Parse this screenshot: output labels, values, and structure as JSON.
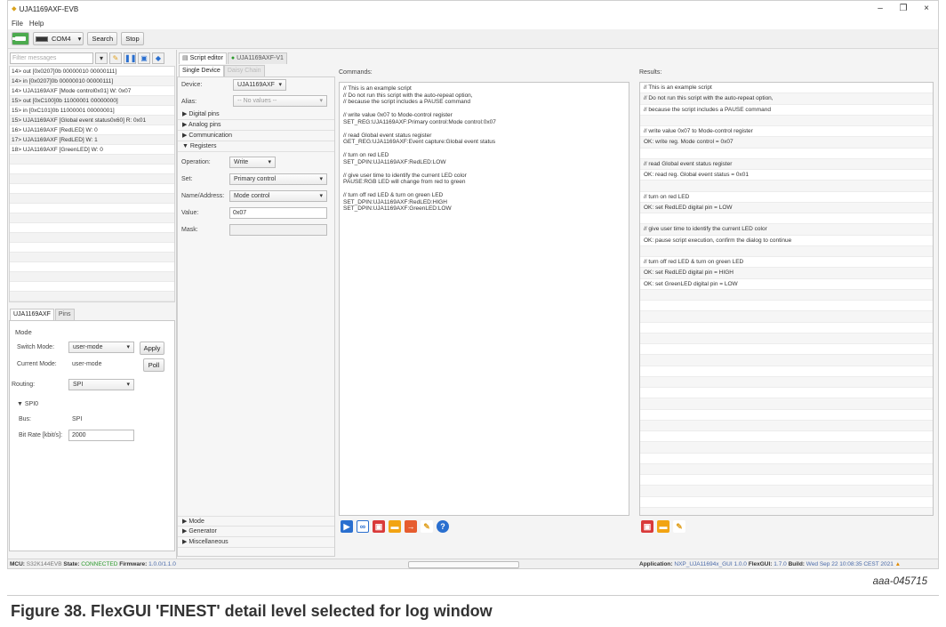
{
  "window": {
    "title": "UJA1169AXF-EVB",
    "min": "–",
    "max": "❐",
    "close": "×"
  },
  "menu": [
    "File",
    "Help"
  ],
  "toolbar": {
    "port": "COM4",
    "search": "Search",
    "stop": "Stop"
  },
  "log": {
    "filter_placeholder": "Filter messages",
    "rows": [
      "14> out [0x0207]0b 00000010 00000111]",
      "14> in [0x0207]0b 00000010 00000111]",
      "14> UJA1169AXF [Mode control0x01] W: 0x07",
      "15> out [0xC100]0b 11000001 00000000]",
      "15> in [0xC101]0b 11000001 00000001]",
      "15> UJA1169AXF [Global event status0x60] R: 0x01",
      "16> UJA1169AXF [RedLED] W: 0",
      "17> UJA1169AXF [RedLED] W: 1",
      "18> UJA1169AXF [GreenLED] W: 0",
      "",
      "",
      "",
      "",
      "",
      "",
      "",
      "",
      "",
      "",
      "",
      "",
      "",
      "",
      ""
    ]
  },
  "device_panel": {
    "tabs": [
      "UJA1169AXF",
      "Pins"
    ],
    "mode_title": "Mode",
    "switch_mode_label": "Switch Mode:",
    "switch_mode_value": "user-mode",
    "apply": "Apply",
    "current_mode_label": "Current Mode:",
    "current_mode_value": "user-mode",
    "poll": "Poll",
    "routing_label": "Routing:",
    "routing_value": "SPI",
    "spi_title": "SPI0",
    "bus_label": "Bus:",
    "bus_value": "SPI",
    "bitrate_label": "Bit Rate [kbit/s]:",
    "bitrate_value": "2000"
  },
  "middle": {
    "top_tabs": [
      "Script editor",
      "UJA1169AXF-V1"
    ],
    "dev_tabs": [
      "Single Device",
      "Daisy Chain"
    ],
    "device_label": "Device:",
    "device_value": "UJA1169AXF",
    "alias_label": "Alias:",
    "alias_value": "-- No values --",
    "sections": [
      "Digital pins",
      "Analog pins",
      "Communication",
      "Registers"
    ],
    "operation_label": "Operation:",
    "operation_value": "Write",
    "set_label": "Set:",
    "set_value": "Primary control",
    "name_label": "Name/Address:",
    "name_value": "Mode control",
    "value_label": "Value:",
    "value_value": "0x07",
    "mask_label": "Mask:",
    "bottom_sections": [
      "Mode",
      "Generator",
      "Miscellaneous"
    ]
  },
  "commands": {
    "header": "Commands:",
    "lines": [
      "// This is an example script",
      "// Do not run this script with the auto-repeat option,",
      "//    because the script includes a PAUSE command",
      "",
      "// write value 0x07 to Mode-control register",
      "SET_REG:UJA1169AXF:Primary control:Mode control:0x07",
      "",
      "// read Global event status register",
      "GET_REG:UJA1169AXF:Event capture:Global event status",
      "",
      "// turn on red LED",
      "SET_DPIN:UJA1169AXF:RedLED:LOW",
      "",
      "// give user time to identify the current LED color",
      "PAUSE:RGB LED will change from red to green",
      "",
      "// turn off red LED & turn on green LED",
      "SET_DPIN:UJA1169AXF:RedLED:HIGH",
      "SET_DPIN:UJA1169AXF:GreenLED:LOW"
    ]
  },
  "results": {
    "header": "Results:",
    "rows": [
      "// This is an example script",
      "// Do not run this script with the auto-repeat option,",
      "//    because the script includes a PAUSE command",
      "",
      "// write value 0x07 to Mode-control register",
      "OK: write reg. Mode control = 0x07",
      "",
      "// read Global event status register",
      "OK: read reg. Global event status = 0x01",
      "",
      "// turn on red LED",
      "OK: set RedLED digital pin = LOW",
      "",
      "// give user time to identify the current LED color",
      "OK: pause script execution, confirm the dialog to continue",
      "",
      "// turn off red LED & turn on green LED",
      "OK: set RedLED digital pin = HIGH",
      "OK: set GreenLED digital pin = LOW",
      "",
      "",
      "",
      "",
      "",
      "",
      "",
      "",
      "",
      "",
      "",
      "",
      "",
      "",
      "",
      "",
      "",
      "",
      "",
      "",
      ""
    ]
  },
  "status": {
    "mcu_label": "MCU:",
    "mcu_value": "S32K144EVB",
    "state_label": "State:",
    "state_value": "CONNECTED",
    "fw_label": "Firmware:",
    "fw_value": "1.0.0/1.1.0",
    "app_label": "Application:",
    "app_value": "NXP_UJA11694x_GUI 1.0.0",
    "flexgui_label": "FlexGUI:",
    "flexgui_value": "1.7.0",
    "build_label": "Build:",
    "build_value": "Wed Sep 22 10:08:35 CEST 2021"
  },
  "figure": {
    "id": "aaa-045715",
    "caption": "Figure 38.  FlexGUI 'FINEST' detail level selected for log window"
  }
}
